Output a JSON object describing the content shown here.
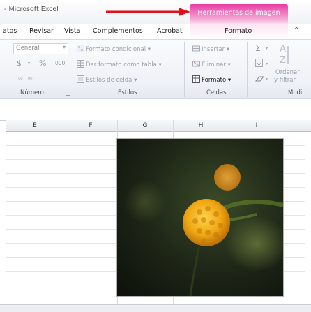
{
  "title_bar": {
    "app_title": "- Microsoft Excel",
    "contextual_tab": "Herramientas de imagen"
  },
  "ribbon_tabs": [
    "atos",
    "Revisar",
    "Vista",
    "Complementos",
    "Acrobat",
    "Formato"
  ],
  "groups": {
    "numero": {
      "label": "Número",
      "format_value": "General",
      "currency": "$",
      "percent": "%",
      "thousands": "000"
    },
    "estilos": {
      "label": "Estilos",
      "items": [
        "Formato condicional",
        "Dar formato como tabla",
        "Estilos de celda"
      ]
    },
    "celdas": {
      "label": "Celdas",
      "items": [
        "Insertar",
        "Eliminar",
        "Formato"
      ]
    },
    "modificar": {
      "label": "Modi",
      "sort_label_1": "Ordenar",
      "sort_label_2": "y filtrar"
    }
  },
  "columns": [
    "E",
    "F",
    "G",
    "H",
    "I"
  ],
  "colors": {
    "context_tab": "#e93aa4",
    "arrow": "#e0101e"
  }
}
